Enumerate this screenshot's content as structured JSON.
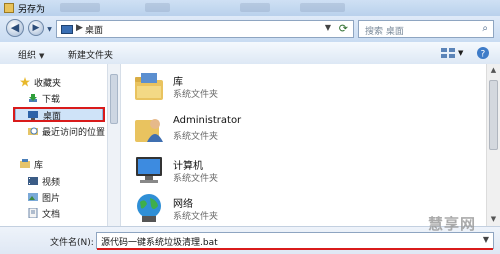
{
  "window": {
    "title": "另存为"
  },
  "address": {
    "crumb": "桌面",
    "separator": "▶",
    "search_placeholder": "搜索 桌面"
  },
  "nav_buttons": {
    "back": "◀",
    "forward": "▶"
  },
  "toolbar": {
    "organize": "组织",
    "new_folder": "新建文件夹"
  },
  "sidebar": {
    "items": [
      {
        "label": "收藏夹",
        "icon": "star-icon"
      },
      {
        "label": "下载",
        "icon": "download-icon"
      },
      {
        "label": "桌面",
        "icon": "desktop-icon",
        "selected": true
      },
      {
        "label": "最近访问的位置",
        "icon": "recent-places-icon"
      },
      {
        "label": "库",
        "icon": "library-icon"
      },
      {
        "label": "视频",
        "icon": "video-icon"
      },
      {
        "label": "图片",
        "icon": "pictures-icon"
      },
      {
        "label": "文档",
        "icon": "documents-icon"
      }
    ]
  },
  "files": [
    {
      "name": "库",
      "type": "系统文件夹",
      "icon": "library-folder-icon"
    },
    {
      "name": "Administrator",
      "type": "系统文件夹",
      "icon": "user-folder-icon"
    },
    {
      "name": "计算机",
      "type": "系统文件夹",
      "icon": "computer-icon"
    },
    {
      "name": "网络",
      "type": "系统文件夹",
      "icon": "network-icon"
    }
  ],
  "filename": {
    "label": "文件名(N):",
    "value": "源代码一键系统垃圾清理.bat"
  },
  "watermark": "慧享网",
  "colors": {
    "highlight_red": "#d91b1b",
    "selection": "#cfe3f8"
  }
}
